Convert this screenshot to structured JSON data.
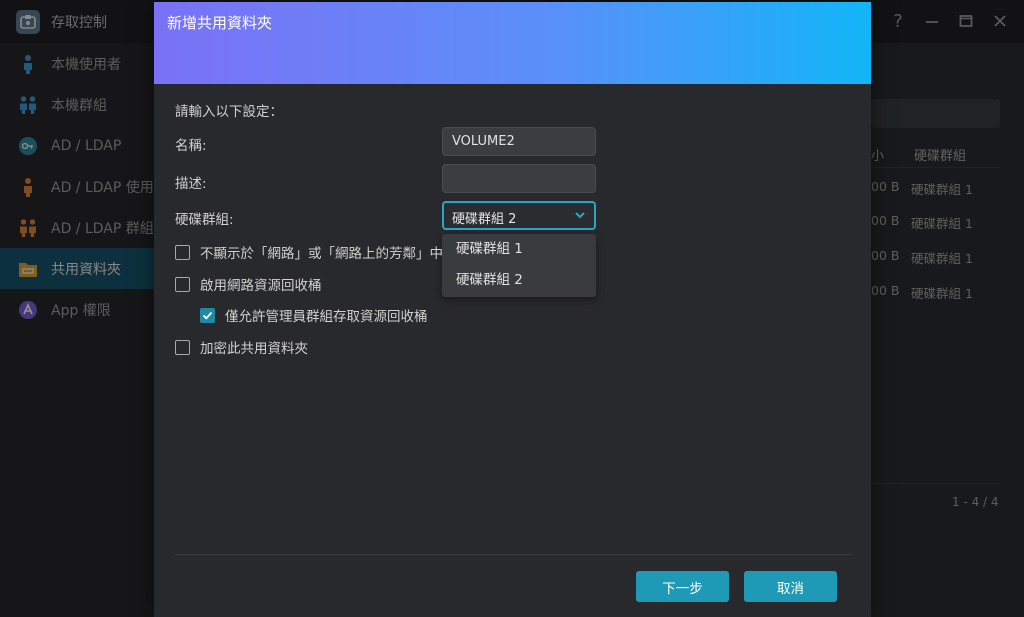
{
  "window": {
    "title": "存取控制",
    "controls": [
      "help-icon",
      "minimize-icon",
      "maximize-icon",
      "close-icon"
    ]
  },
  "sidebar": {
    "items": [
      {
        "label": "本機使用者",
        "icon": "user-icon"
      },
      {
        "label": "本機群組",
        "icon": "group-icon"
      },
      {
        "label": "AD / LDAP",
        "icon": "key-icon"
      },
      {
        "label": "AD / LDAP 使用者",
        "icon": "user-icon"
      },
      {
        "label": "AD / LDAP 群組",
        "icon": "group-icon"
      },
      {
        "label": "共用資料夾",
        "icon": "folder-icon",
        "active": true
      },
      {
        "label": "App 權限",
        "icon": "app-icon"
      }
    ]
  },
  "table": {
    "headers": [
      "小",
      "硬碟群組"
    ],
    "rows": [
      {
        "size": "00 B",
        "volume": "硬碟群組 1"
      },
      {
        "size": "00 B",
        "volume": "硬碟群組 1"
      },
      {
        "size": "00 B",
        "volume": "硬碟群組 1"
      },
      {
        "size": "00 B",
        "volume": "硬碟群組 1"
      }
    ],
    "pager": "1 - 4 / 4"
  },
  "dialog": {
    "title": "新增共用資料夾",
    "intro": "請輸入以下設定：",
    "name_label": "名稱:",
    "name_value": "VOLUME2",
    "description_label": "描述:",
    "description_value": "",
    "volume_label": "硬碟群組:",
    "volume_selected": "硬碟群組 2",
    "volume_options": [
      "硬碟群組 1",
      "硬碟群組 2"
    ],
    "checkboxes": [
      {
        "label": "不顯示於「網路」或「網路上的芳鄰」中",
        "checked": false
      },
      {
        "label": "啟用網路資源回收桶",
        "checked": false
      },
      {
        "label": "僅允許管理員群組存取資源回收桶",
        "checked": true
      },
      {
        "label": "加密此共用資料夾",
        "checked": false
      }
    ],
    "next_button": "下一步",
    "cancel_button": "取消"
  },
  "colors": {
    "accent": "#1f9ab6",
    "header_gradient_start": "#7b71f5",
    "header_gradient_end": "#12b5f7",
    "sidebar_active": "#16536b"
  }
}
